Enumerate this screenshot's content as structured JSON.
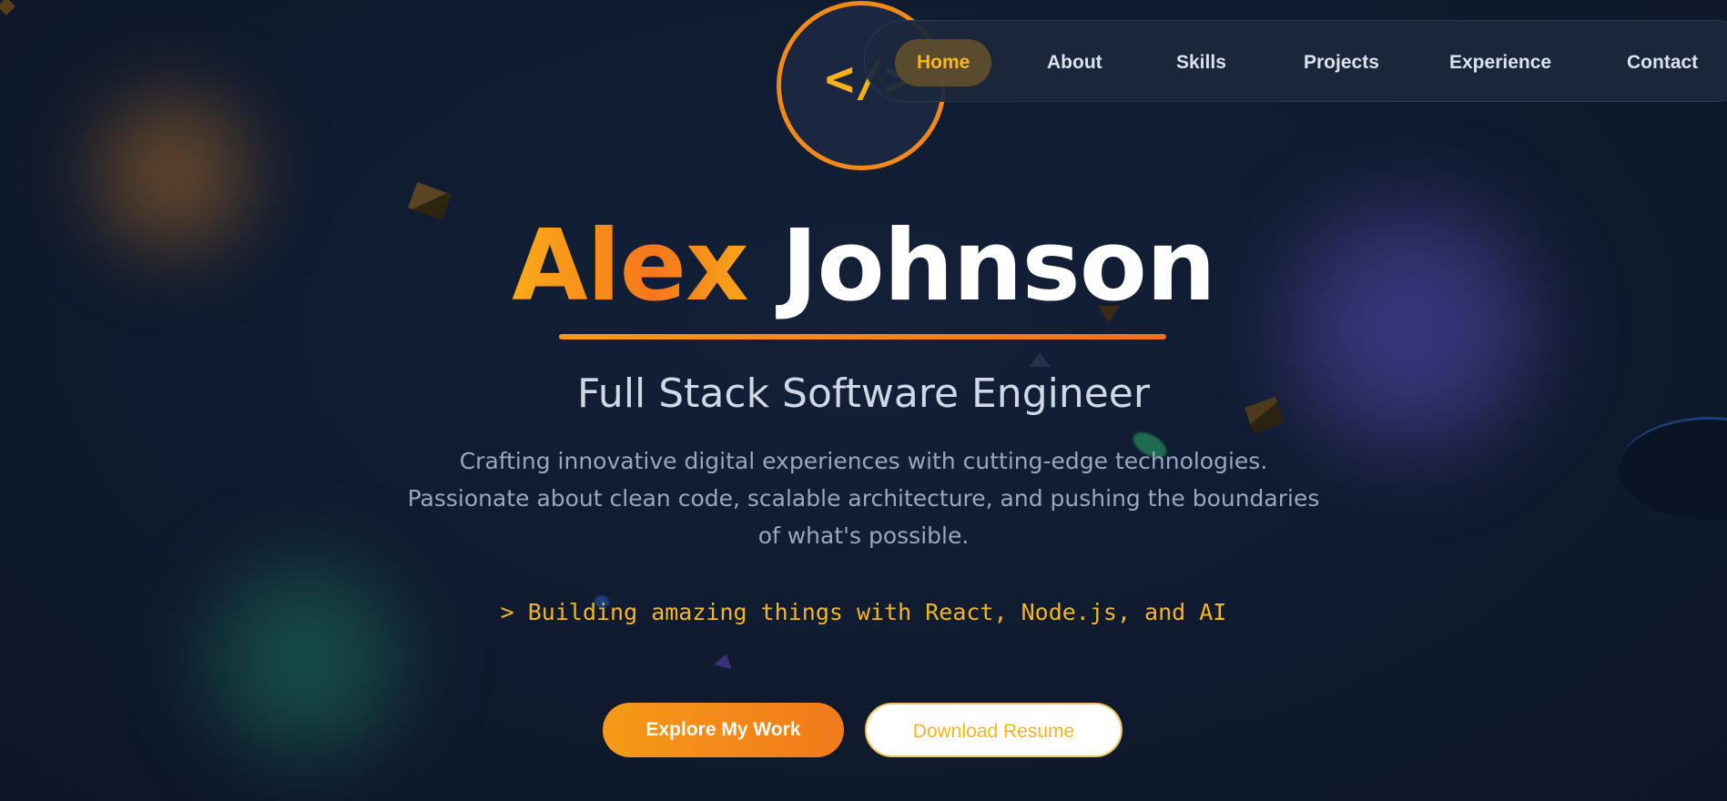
{
  "hero": {
    "logo_symbol": "</>",
    "name_first": "Alex",
    "name_last": "Johnson",
    "role": "Full Stack Software Engineer",
    "description": "Crafting innovative digital experiences with cutting-edge technologies. Passionate about clean code, scalable architecture, and pushing the boundaries of what's possible.",
    "terminal_line": "> Building amazing things with React, Node.js, and AI"
  },
  "nav": {
    "items": [
      {
        "label": "Home",
        "active": true
      },
      {
        "label": "About",
        "active": false
      },
      {
        "label": "Skills",
        "active": false
      },
      {
        "label": "Projects",
        "active": false
      },
      {
        "label": "Experience",
        "active": false
      },
      {
        "label": "Contact",
        "active": false
      }
    ]
  },
  "buttons": {
    "primary_label": "Explore My Work",
    "secondary_label": "Download Resume"
  },
  "colors": {
    "background": "#101a2e",
    "accent_orange": "#f59a16",
    "accent_yellow": "#f5b720",
    "nav_active_bg": "#5a4a2e",
    "text_primary": "#ffffff",
    "text_muted": "#9aa6bb"
  },
  "icons": {
    "logo": "code-brackets-icon"
  }
}
